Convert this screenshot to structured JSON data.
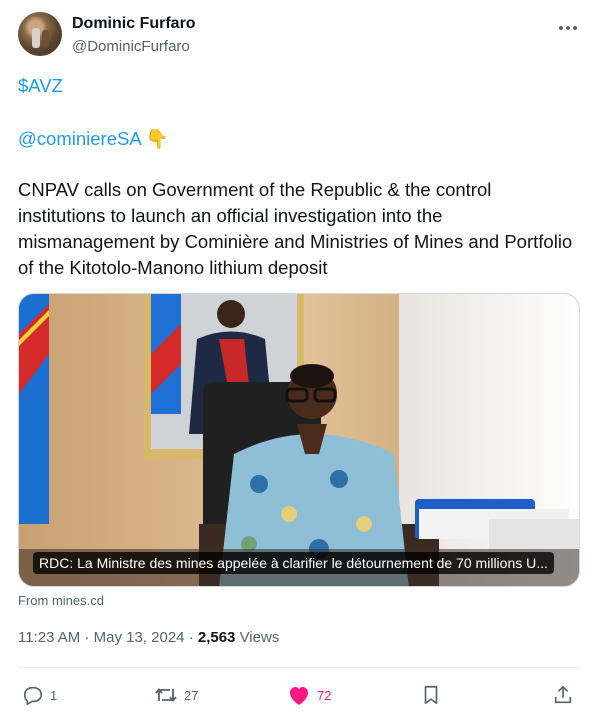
{
  "author": {
    "name": "Dominic Furfaro",
    "handle": "@DominicFurfaro"
  },
  "tweet": {
    "cashtag": "$AVZ",
    "mention": "@cominiereSA",
    "mention_emoji": "👇",
    "body": "CNPAV calls on Government of the Republic & the control institutions to launch an official investigation into the mismanagement by Cominière and Ministries of Mines and Portfolio of the Kitotolo-Manono lithium deposit"
  },
  "card": {
    "caption": "RDC: La Ministre des mines appelée à clarifier le détournement de 70 millions U...",
    "source": "From mines.cd"
  },
  "meta": {
    "time": "11:23 AM",
    "separator1": " · ",
    "date": "May 13, 2024",
    "separator2": " · ",
    "views_count": "2,563",
    "views_label": " Views"
  },
  "actions": {
    "replies": "1",
    "reposts": "27",
    "likes": "72",
    "bookmark_icon": "bookmark-icon",
    "share_icon": "share-icon"
  },
  "colors": {
    "link": "#1d9bf0",
    "like": "#f91880",
    "muted": "#536471"
  }
}
